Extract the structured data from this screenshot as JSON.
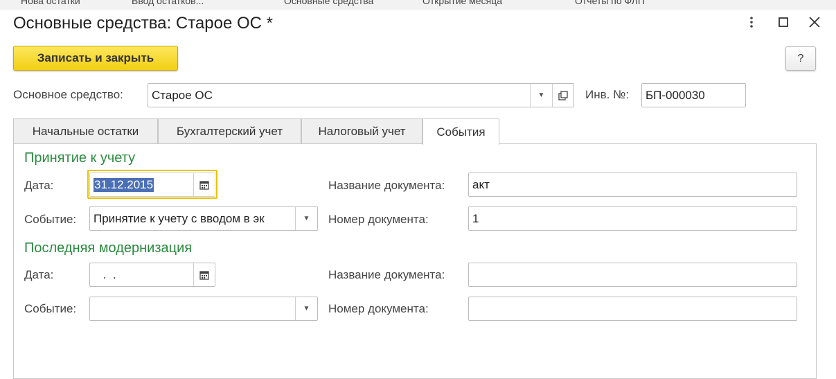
{
  "background_tabs": [
    "Нова остатки",
    "Ввод остатков...",
    "Основные средства",
    "Открытие месяца",
    "Отчеты по ФЛП"
  ],
  "window": {
    "title": "Основные средства: Старое ОС *",
    "more_icon": "more-vertical-icon",
    "maximize_icon": "maximize-icon",
    "close_icon": "close-icon"
  },
  "toolbar": {
    "save_close_label": "Записать и закрыть",
    "help_label": "?"
  },
  "header": {
    "asset_label": "Основное средство:",
    "asset_value": "Старое ОС",
    "inv_label": "Инв. №:",
    "inv_value": "БП-000030"
  },
  "tabs": [
    {
      "label": "Начальные остатки",
      "active": false
    },
    {
      "label": "Бухгалтерский учет",
      "active": false
    },
    {
      "label": "Налоговый учет",
      "active": false
    },
    {
      "label": "События",
      "active": true
    }
  ],
  "acceptance": {
    "title": "Принятие к учету",
    "date_label": "Дата:",
    "date_value": "31.12.2015",
    "event_label": "Событие:",
    "event_value": "Принятие к учету с вводом в эк",
    "doc_name_label": "Название документа:",
    "doc_name_value": "акт",
    "doc_num_label": "Номер документа:",
    "doc_num_value": "1"
  },
  "modernization": {
    "title": "Последняя модернизация",
    "date_label": "Дата:",
    "date_value": " .  .",
    "event_label": "Событие:",
    "event_value": "",
    "doc_name_label": "Название документа:",
    "doc_name_value": "",
    "doc_num_label": "Номер документа:",
    "doc_num_value": ""
  },
  "colors": {
    "accent_yellow": "#f5d623",
    "section_green": "#2a8a3e",
    "focus_border": "#e8c400",
    "selection": "#4a6fb5"
  }
}
